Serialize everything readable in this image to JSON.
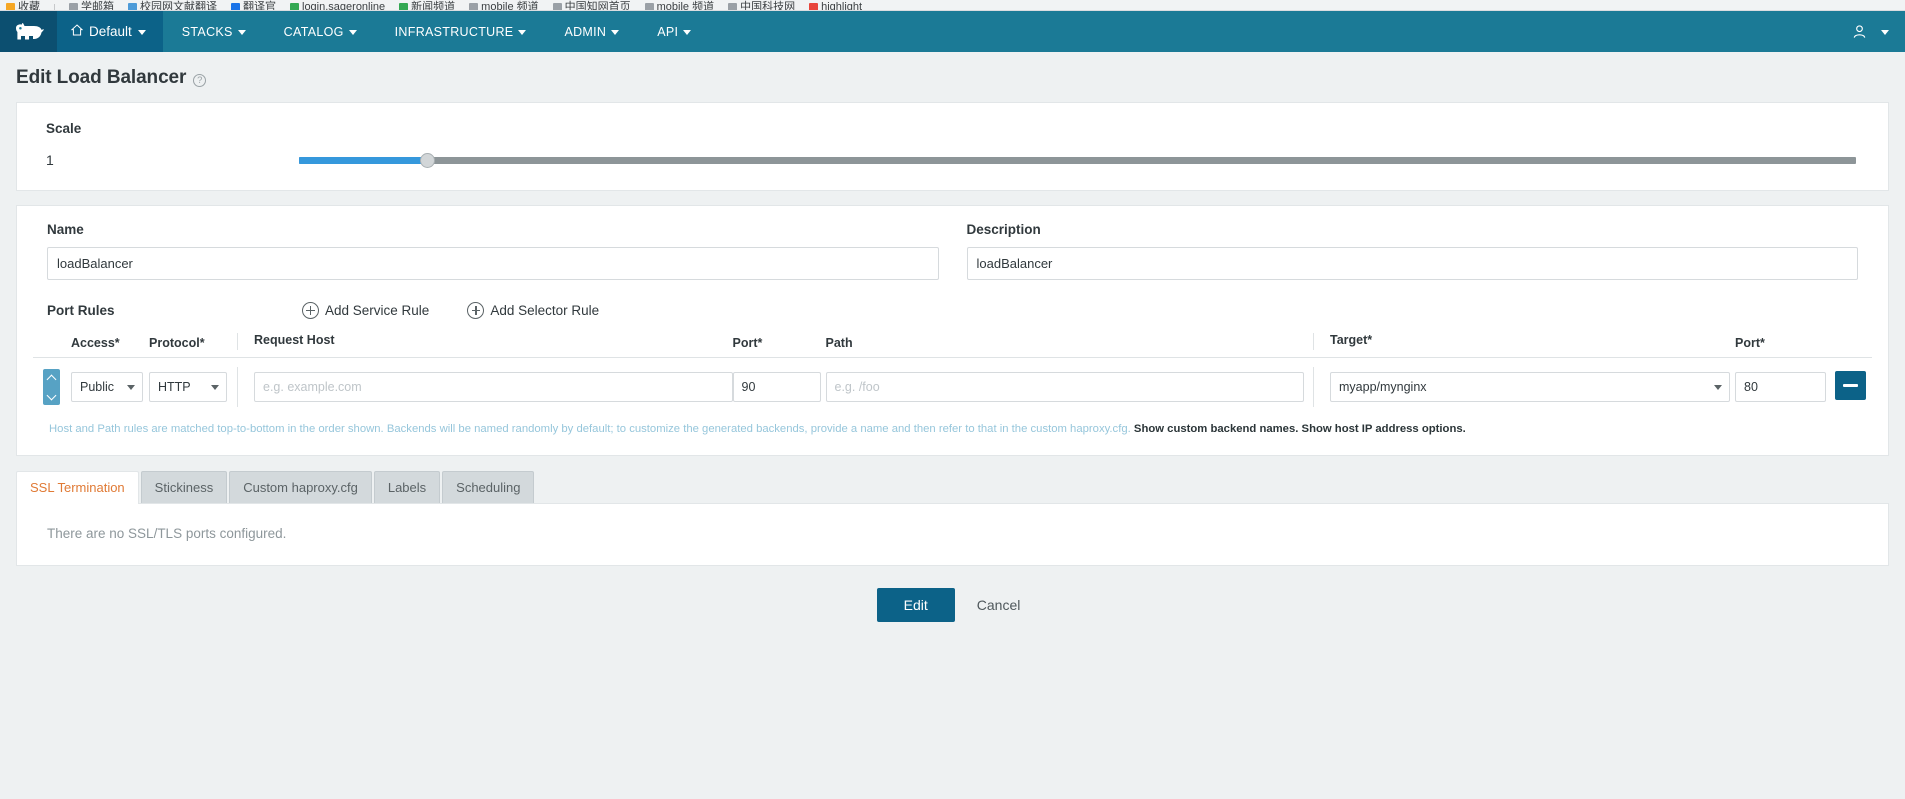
{
  "browser": {
    "bookmarks": [
      {
        "label": "收藏",
        "color": "#f5a623"
      },
      {
        "label": "学邮箱",
        "color": "#9aa0a6"
      },
      {
        "label": "校园网文献翻译",
        "color": "#4d9bd8"
      },
      {
        "label": "翻译官",
        "color": "#1a73e8"
      },
      {
        "label": "login.sageronline",
        "color": "#34a853"
      },
      {
        "label": "新闻频道",
        "color": "#34a853"
      },
      {
        "label": "mobile 频道",
        "color": "#9aa0a6"
      },
      {
        "label": "中国知网首页",
        "color": "#9aa0a6"
      },
      {
        "label": "mobile 频道",
        "color": "#9aa0a6"
      },
      {
        "label": "中国科技网",
        "color": "#9aa0a6"
      },
      {
        "label": "highlight",
        "color": "#e8453c"
      }
    ]
  },
  "topnav": {
    "logo_icon": "rancher-cow-icon",
    "environment": {
      "label": "Default",
      "home_icon": "home-icon",
      "caret_icon": "chevron-down-icon"
    },
    "items": [
      {
        "label": "STACKS",
        "caret": true
      },
      {
        "label": "CATALOG",
        "caret": true
      },
      {
        "label": "INFRASTRUCTURE",
        "caret": true
      },
      {
        "label": "ADMIN",
        "caret": true
      },
      {
        "label": "API",
        "caret": true
      }
    ],
    "user_icon": "user-icon",
    "user_caret_icon": "chevron-down-icon",
    "bg_color": "#1b7a96",
    "logo_bg_color": "#0c4f70",
    "env_bg_color": "#0c6288"
  },
  "page": {
    "title": "Edit Load Balancer",
    "help_icon": "question-mark-icon"
  },
  "scale": {
    "label": "Scale",
    "value": "1",
    "slider_percent": 8.2,
    "fill_color": "#3598dc",
    "track_color": "#8d9598"
  },
  "name_field": {
    "label": "Name",
    "value": "loadBalancer",
    "placeholder": ""
  },
  "description_field": {
    "label": "Description",
    "value": "loadBalancer",
    "placeholder": ""
  },
  "port_rules": {
    "title": "Port Rules",
    "add_service_rule": "Add Service Rule",
    "add_selector_rule": "Add Selector Rule",
    "plus_icon": "plus-circle-icon",
    "headers": {
      "access": "Access*",
      "protocol": "Protocol*",
      "request_host": "Request Host",
      "port_source": "Port*",
      "path": "Path",
      "target": "Target*",
      "port_target": "Port*"
    },
    "rows": [
      {
        "reorder_icon": "reorder-up-down-icon",
        "access": "Public",
        "protocol": "HTTP",
        "request_host": "",
        "request_host_placeholder": "e.g. example.com",
        "port_source": "90",
        "path": "",
        "path_placeholder": "e.g. /foo",
        "target": "myapp/mynginx",
        "port_target": "80",
        "remove_icon": "minus-icon"
      }
    ],
    "note_text": "Host and Path rules are matched top-to-bottom in the order shown. Backends will be named randomly by default; to customize the generated backends, provide a name and then refer to that in the custom haproxy.cfg.",
    "note_link_1": "Show custom backend names.",
    "note_link_2": "Show host IP address options."
  },
  "tabs": {
    "items": [
      {
        "label": "SSL Termination",
        "active": true
      },
      {
        "label": "Stickiness",
        "active": false
      },
      {
        "label": "Custom haproxy.cfg",
        "active": false
      },
      {
        "label": "Labels",
        "active": false
      },
      {
        "label": "Scheduling",
        "active": false
      }
    ],
    "active_color": "#e07a35",
    "panel_text": "There are no SSL/TLS ports configured."
  },
  "footer": {
    "submit_label": "Edit",
    "cancel_label": "Cancel",
    "primary_color": "#0c6288"
  }
}
